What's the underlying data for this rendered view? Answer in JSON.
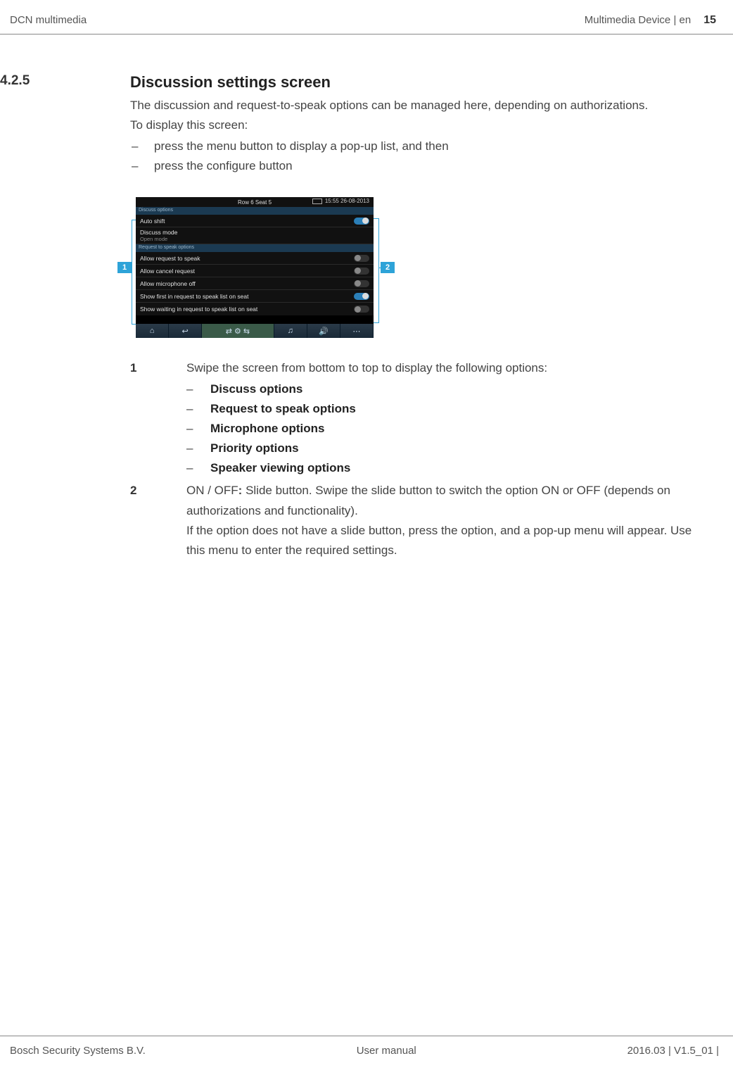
{
  "header": {
    "left": "DCN multimedia",
    "right_text": "Multimedia Device | en",
    "page_number": "15"
  },
  "section": {
    "number": "4.2.5",
    "title": "Discussion settings screen",
    "intro_1": "The discussion and request-to-speak options can be managed here, depending on authorizations.",
    "intro_2": "To display this screen:",
    "bullets": [
      "press the menu button to display a pop-up list, and then",
      "press the configure button"
    ]
  },
  "screenshot": {
    "top_center": "Row 6 Seat 5",
    "top_right": "15:55 26-08-2013",
    "section_a": "Discuss options",
    "row_auto_shift": "Auto shift",
    "row_discuss_mode": "Discuss mode",
    "row_discuss_mode_sub": "Open mode",
    "section_b": "Request to speak options",
    "row_allow_req": "Allow request to speak",
    "row_allow_cancel": "Allow cancel request",
    "row_allow_mic_off": "Allow microphone off",
    "row_show_first": "Show first in request to speak list on seat",
    "row_show_waiting": "Show waiting in request to speak list on seat"
  },
  "callouts": {
    "c1": "1",
    "c2": "2"
  },
  "legend": {
    "row1_num": "1",
    "row1_text": "Swipe the screen from bottom to top to display the following options:",
    "row1_items": [
      "Discuss options",
      "Request to speak options",
      "Microphone options",
      "Priority options",
      "Speaker viewing options"
    ],
    "row2_num": "2",
    "row2_a_prefix": "ON / OFF",
    "row2_a_bold": ":",
    "row2_a_rest": " Slide button. Swipe the slide button to switch the option ON or OFF (depends on authorizations and functionality).",
    "row2_b": "If the option does not have a slide button, press the option, and a pop-up menu will appear. Use this menu to enter the required settings."
  },
  "footer": {
    "left": "Bosch Security Systems B.V.",
    "center": "User manual",
    "right": "2016.03 | V1.5_01 |"
  }
}
